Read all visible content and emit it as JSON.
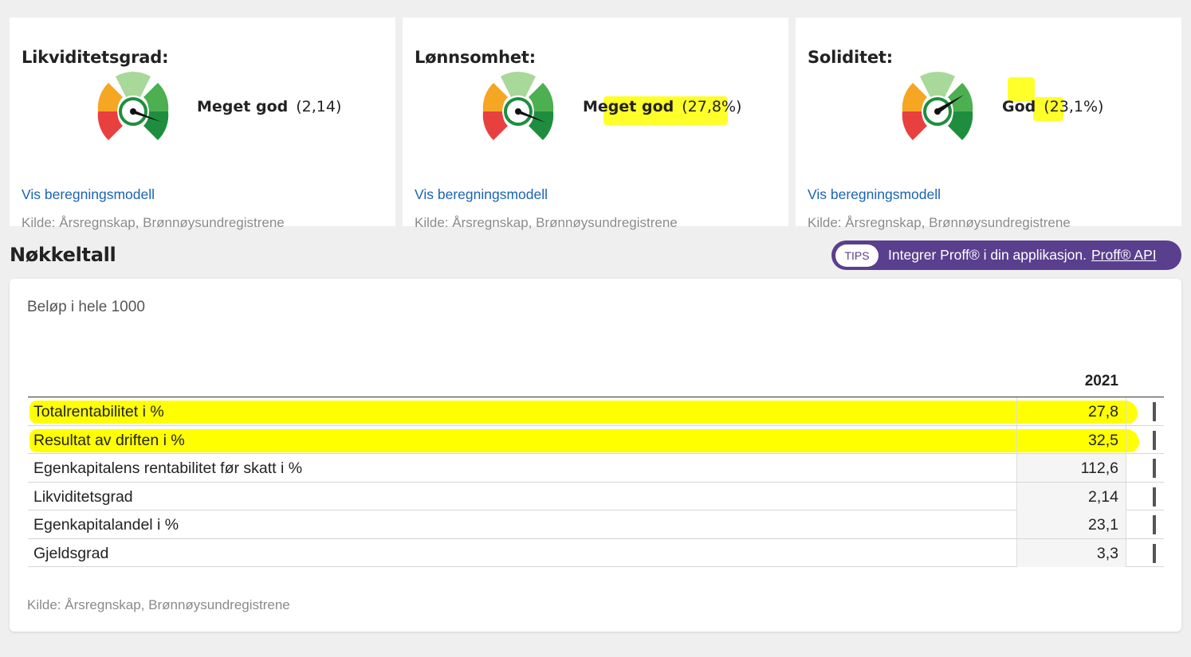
{
  "cards": [
    {
      "title": "Likviditetsgrad:",
      "rating_label": "Meget god",
      "rating_value": "(2,14)",
      "link": "Vis beregningsmodell",
      "source": "Kilde: Årsregnskap, Brønnøysundregistrene"
    },
    {
      "title": "Lønnsomhet:",
      "rating_label": "Meget god",
      "rating_value": "(27,8%)",
      "link": "Vis beregningsmodell",
      "source": "Kilde: Årsregnskap, Brønnøysundregistrene"
    },
    {
      "title": "Soliditet:",
      "rating_label": "God",
      "rating_value": "(23,1%)",
      "link": "Vis beregningsmodell",
      "source": "Kilde: Årsregnskap, Brønnøysundregistrene"
    }
  ],
  "gauge_colors": {
    "red": "#e8403e",
    "orange": "#f5a623",
    "light_green": "#a8d89a",
    "green": "#4caf50",
    "dark_green": "#1e8e3e"
  },
  "section": {
    "title": "Nøkkeltall"
  },
  "tips": {
    "badge": "TIPS",
    "text": "Integrer Proff® i din applikasjon.",
    "link": "Proff® API",
    "color": "#5a3f8e"
  },
  "panel": {
    "unit_note": "Beløp i hele 1000",
    "year": "2021",
    "rows": [
      {
        "label": "Totalrentabilitet i %",
        "value": "27,8"
      },
      {
        "label": "Resultat av driften i %",
        "value": "32,5"
      },
      {
        "label": "Egenkapitalens rentabilitet før skatt i %",
        "value": "112,6"
      },
      {
        "label": "Likviditetsgrad",
        "value": "2,14"
      },
      {
        "label": "Egenkapitalandel i %",
        "value": "23,1"
      },
      {
        "label": "Gjeldsgrad",
        "value": "3,3"
      }
    ],
    "source": "Kilde: Årsregnskap, Brønnøysundregistrene"
  },
  "highlight_color": "#ffff00"
}
